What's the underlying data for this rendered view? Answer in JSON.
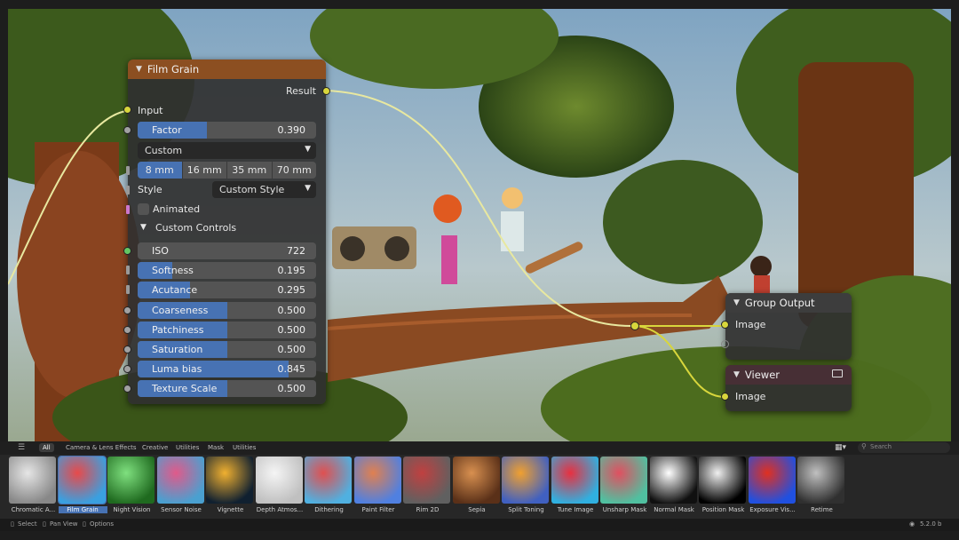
{
  "film_grain_node": {
    "title": "Film Grain",
    "output_label": "Result",
    "input_label": "Input",
    "factor": {
      "label": "Factor",
      "value": "0.390",
      "amount": 0.39
    },
    "preset": "Custom",
    "sizes": [
      "8 mm",
      "16 mm",
      "35 mm",
      "70 mm"
    ],
    "style_label": "Style",
    "style_value": "Custom Style",
    "animated_label": "Animated",
    "custom_controls_label": "Custom Controls",
    "controls": [
      {
        "label": "ISO",
        "value": "722",
        "amount": 0.0
      },
      {
        "label": "Softness",
        "value": "0.195",
        "amount": 0.195
      },
      {
        "label": "Acutance",
        "value": "0.295",
        "amount": 0.295
      },
      {
        "label": "Coarseness",
        "value": "0.500",
        "amount": 0.5
      },
      {
        "label": "Patchiness",
        "value": "0.500",
        "amount": 0.5
      },
      {
        "label": "Saturation",
        "value": "0.500",
        "amount": 0.5
      },
      {
        "label": "Luma bias",
        "value": "0.845",
        "amount": 0.845
      },
      {
        "label": "Texture Scale",
        "value": "0.500",
        "amount": 0.5
      }
    ]
  },
  "group_output_node": {
    "title": "Group Output",
    "input_label": "Image"
  },
  "viewer_node": {
    "title": "Viewer",
    "input_label": "Image"
  },
  "asset_tabs": {
    "items": [
      "All",
      "Camera & Lens Effects",
      "Creative",
      "Utilities",
      "Mask",
      "Utilities"
    ],
    "search_placeholder": "Search"
  },
  "assets": [
    {
      "name": "Chromatic A...",
      "colors": [
        "#e6e6e6",
        "#888888"
      ]
    },
    {
      "name": "Film Grain",
      "colors": [
        "#e84a4a",
        "#3aa0e0"
      ],
      "selected": true
    },
    {
      "name": "Night Vision",
      "colors": [
        "#7fe07f",
        "#1f6a1f"
      ]
    },
    {
      "name": "Sensor Noise",
      "colors": [
        "#e05a8a",
        "#4aa0d0"
      ]
    },
    {
      "name": "Vignette",
      "colors": [
        "#f0b030",
        "#102030"
      ]
    },
    {
      "name": "Depth Atmos...",
      "colors": [
        "#f5f5f5",
        "#c0c0c0"
      ]
    },
    {
      "name": "Dithering",
      "colors": [
        "#e05050",
        "#50b0e0"
      ]
    },
    {
      "name": "Paint Filter",
      "colors": [
        "#e08050",
        "#5080e0"
      ]
    },
    {
      "name": "Rim 2D",
      "colors": [
        "#c04040",
        "#606060"
      ]
    },
    {
      "name": "Sepia",
      "colors": [
        "#d89050",
        "#5a3018"
      ]
    },
    {
      "name": "Split Toning",
      "colors": [
        "#f0a030",
        "#4060c0"
      ]
    },
    {
      "name": "Tune Image",
      "colors": [
        "#e83040",
        "#30b0e0"
      ]
    },
    {
      "name": "Unsharp Mask",
      "colors": [
        "#e05060",
        "#50c0a0"
      ]
    },
    {
      "name": "Normal Mask",
      "colors": [
        "#ffffff",
        "#101010"
      ]
    },
    {
      "name": "Position Mask",
      "colors": [
        "#f0f0f0",
        "#000000"
      ]
    },
    {
      "name": "Exposure Vis...",
      "colors": [
        "#e03020",
        "#2050e0"
      ]
    },
    {
      "name": "Retime",
      "colors": [
        "#c0c0c0",
        "#303030"
      ]
    }
  ],
  "status_bar": {
    "select": "Select",
    "pan": "Pan View",
    "options": "Options",
    "version": "5.2.0 b"
  },
  "colors": {
    "accent": "#4772b3",
    "film_grain_header": "#8c4f21",
    "viewer_header": "#472f35",
    "wire": "#e8e8a0"
  }
}
